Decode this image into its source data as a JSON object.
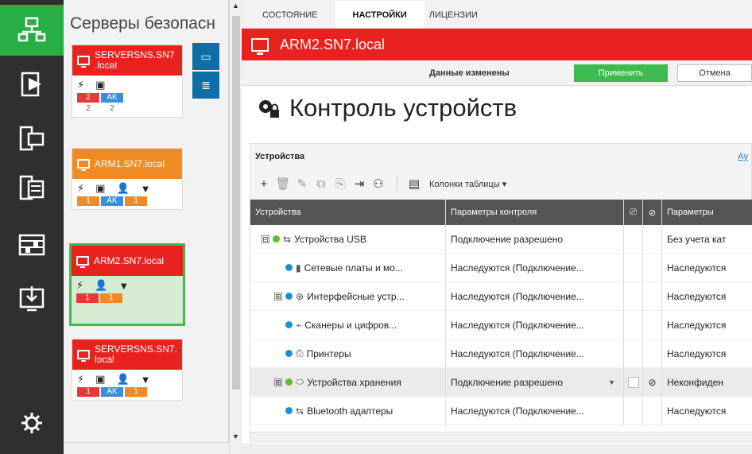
{
  "rail": {
    "items": [
      {
        "icon": "network-icon",
        "active": true
      },
      {
        "icon": "shield-icon",
        "active": false
      },
      {
        "icon": "workstation-icon",
        "active": false
      },
      {
        "icon": "server-icon",
        "active": false
      },
      {
        "icon": "switch-icon",
        "active": false
      },
      {
        "icon": "download-icon",
        "active": false
      }
    ],
    "settings_icon": "gear-icon"
  },
  "server_panel": {
    "title": "Серверы безопасн",
    "cards": [
      {
        "name": "SERVERSNS.SN7 .local",
        "color": "#e8231f",
        "icons": [
          "⚡",
          "▣"
        ],
        "tags": [
          {
            "text": "2",
            "style": "red"
          },
          {
            "text": "AK",
            "style": "blue"
          }
        ],
        "sub": [
          "2",
          "2"
        ]
      },
      {
        "name": "ARM1.SN7.local",
        "color": "#f08a24",
        "icons": [
          "⚡",
          "▣",
          "👤",
          "▼"
        ],
        "tags": [
          {
            "text": "1",
            "style": "orange"
          },
          {
            "text": "AK",
            "style": "blue"
          },
          {
            "text": "1",
            "style": "orange"
          }
        ]
      },
      {
        "name": "ARM2.SN7.local",
        "color": "#e8231f",
        "icons": [
          "⚡",
          "👤",
          "▼"
        ],
        "tags": [
          {
            "text": "1",
            "style": "red"
          },
          {
            "text": "1",
            "style": "orange"
          }
        ]
      },
      {
        "name": "SERVERSNS.SN7. local",
        "color": "#e8231f",
        "icons": [
          "⚡",
          "▣",
          "👤",
          "▼"
        ],
        "tags": [
          {
            "text": "1",
            "style": "red"
          },
          {
            "text": "AK",
            "style": "blue"
          },
          {
            "text": "1",
            "style": "orange"
          }
        ]
      }
    ]
  },
  "tabs": [
    {
      "label": "СОСТОЯНИЕ",
      "active": false
    },
    {
      "label": "НАСТРОЙКИ",
      "active": true
    },
    {
      "label": "ЛИЦЕНЗИИ",
      "active": false
    }
  ],
  "host_title": "ARM2.SN7.local",
  "actionbar": {
    "changed": "Данные изменены",
    "apply": "Применить",
    "cancel": "Отмена"
  },
  "page_heading": "Контроль устройств",
  "section": {
    "title": "Устройства",
    "link": "Ау",
    "columns_button": "Колонки таблицы ▾"
  },
  "grid": {
    "headers": [
      "Устройства",
      "Параметры контроля",
      "",
      "",
      "Параметры"
    ],
    "rows": [
      {
        "expand": "⊟",
        "dot": "green",
        "icon": "usb-icon",
        "glyph": "⇆",
        "indent": 0,
        "name": "Устройства USB",
        "param": "Подключение разрешено",
        "extra": "Без учета кат",
        "selected": false
      },
      {
        "expand": "",
        "dot": "blue",
        "icon": "network-card-icon",
        "glyph": "▮",
        "indent": 30,
        "name": "Сетевые платы и мо...",
        "param": "Наследуются (Подключение...",
        "extra": "Наследуются",
        "selected": false
      },
      {
        "expand": "⊞",
        "dot": "blue",
        "icon": "interface-icon",
        "glyph": "⊕",
        "indent": 16,
        "name": "Интерфейсные устр...",
        "param": "Наследуются (Подключение...",
        "extra": "Наследуются",
        "selected": false
      },
      {
        "expand": "",
        "dot": "blue",
        "icon": "scanner-icon",
        "glyph": "⌁",
        "indent": 30,
        "name": "Сканеры и цифров...",
        "param": "Наследуются (Подключение...",
        "extra": "Наследуются",
        "selected": false
      },
      {
        "expand": "",
        "dot": "blue",
        "icon": "printer-icon",
        "glyph": "⎙",
        "indent": 30,
        "name": "Принтеры",
        "param": "Наследуются (Подключение...",
        "extra": "Наследуются",
        "selected": false
      },
      {
        "expand": "⊞",
        "dot": "green",
        "icon": "storage-icon",
        "glyph": "⬭",
        "indent": 16,
        "name": "Устройства хранения",
        "param": "Подключение разрешено",
        "extra": "Неконфиден",
        "selected": true
      },
      {
        "expand": "",
        "dot": "blue",
        "icon": "bluetooth-icon",
        "glyph": "⇆",
        "indent": 30,
        "name": "Bluetooth адаптеры",
        "param": "Наследуются (Подключение...",
        "extra": "Наследуются",
        "selected": false
      }
    ]
  },
  "colors": {
    "rail_bg": "#2f2f2f",
    "accent_green": "#27ae45",
    "title_red": "#e8231f",
    "apply_green": "#3dbb4f",
    "grid_header": "#555555"
  }
}
